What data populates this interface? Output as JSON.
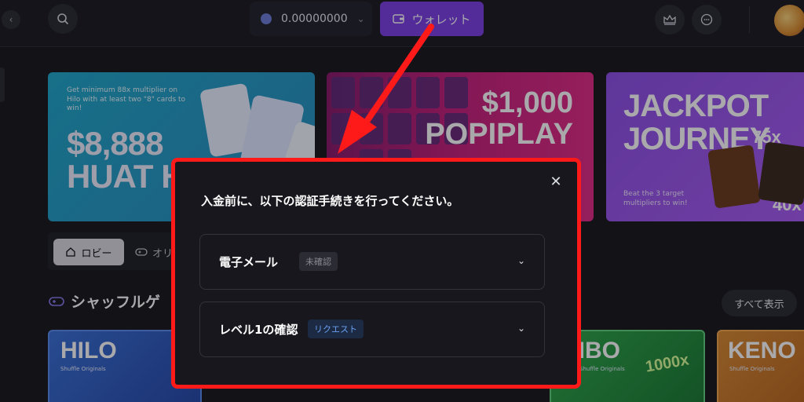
{
  "header": {
    "balance": "0.00000000",
    "wallet_label": "ウォレット"
  },
  "banners": {
    "hilo": {
      "subtitle": "Get minimum 88x multiplier on Hilo with at least two \"8\" cards to win!",
      "headline": "$8,888\nHUAT H"
    },
    "popiplay": {
      "headline": "$1,000\nPOPIPLAY"
    },
    "jackpot": {
      "headline": "JACKPOT\nJOURNEY",
      "multiplier_a": "75x",
      "multiplier_b": "40x",
      "subtitle": "Beat the 3 target multipliers to win!"
    }
  },
  "tabs": {
    "lobby": "ロビー",
    "originals": "オリ"
  },
  "section": {
    "title": "シャッフルゲ",
    "show_all": "すべて表示"
  },
  "games": {
    "hilo": {
      "title": "HILO",
      "sub": "Shuffle Originals"
    },
    "combo": {
      "title": "MBO",
      "sub": "Shuffle Originals",
      "tag": "1000x"
    },
    "keno": {
      "title": "KENO",
      "sub": "Shuffle Originals"
    }
  },
  "modal": {
    "title": "入金前に、以下の認証手続きを行ってください。",
    "items": [
      {
        "label": "電子メール",
        "badge": "未確認"
      },
      {
        "label": "レベル1の確認",
        "badge": "リクエスト"
      }
    ]
  },
  "colors": {
    "accent": "#7b3fe4",
    "highlight_border": "#ff1a1a",
    "arrow": "#ff1a1a"
  }
}
